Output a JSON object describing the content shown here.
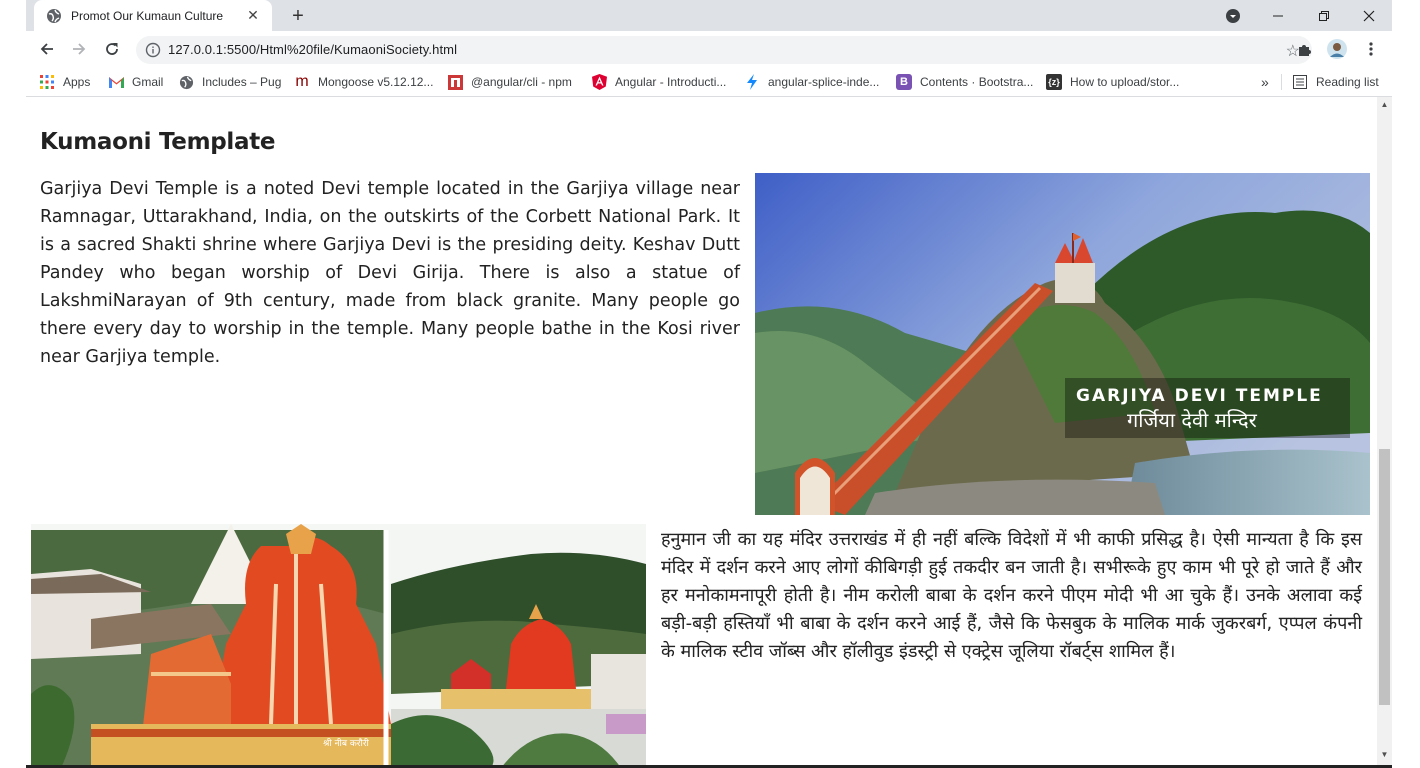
{
  "browser": {
    "tab_title": "Promot Our Kumaun Culture",
    "url": "127.0.0.1:5500/Html%20file/KumaoniSociety.html"
  },
  "bookmarks": [
    {
      "label": "Apps",
      "icon": "apps-grid-icon"
    },
    {
      "label": "Gmail",
      "icon": "gmail-icon"
    },
    {
      "label": "Includes – Pug",
      "icon": "globe-icon"
    },
    {
      "label": "Mongoose v5.12.12...",
      "icon": "mongoose-icon"
    },
    {
      "label": "@angular/cli - npm",
      "icon": "npm-icon"
    },
    {
      "label": "Angular - Introducti...",
      "icon": "angular-icon"
    },
    {
      "label": "angular-splice-inde...",
      "icon": "bolt-icon"
    },
    {
      "label": "Contents · Bootstra...",
      "icon": "bootstrap-icon"
    },
    {
      "label": "How to upload/stor...",
      "icon": "code-icon"
    }
  ],
  "reading_list_label": "Reading list",
  "more_bookmarks": "»",
  "page": {
    "heading": "Kumaoni Template",
    "paragraph1": "Garjiya Devi Temple is a noted Devi temple located in the Garjiya village near Ramnagar, Uttarakhand, India, on the outskirts of the Corbett National Park. It is a sacred Shakti shrine where Garjiya Devi is the presiding deity. Keshav Dutt Pandey who began worship of Devi Girija. There is also a statue of LakshmiNarayan of 9th century, made from black granite. Many people go there every day to worship in the temple. Many people bathe in the Kosi river near Garjiya temple.",
    "image1_caption_en": "GARJIYA DEVI TEMPLE",
    "image1_caption_hi": "गर्जिया देवी मन्दिर",
    "image2_caption": "श्री नीब करौरी",
    "paragraph2": "हनुमान जी का यह मंदिर उत्तराखंड में ही नहीं बल्कि विदेशों में भी काफी प्रसिद्ध है। ऐसी मान्यता है कि इस मंदिर में दर्शन करने आए लोगों कीबिगड़ी हुई तकदीर बन जाती है। सभीरूके हुए काम भी पूरे हो जाते हैं और हर मनोकामनापूरी होती है। नीम करोली बाबा के दर्शन करने पीएम मोदी भी आ चुके हैं। उनके अलावा कई बड़ी-बड़ी हस्तियाँ भी बाबा के दर्शन करने आई हैं, जैसे कि फेसबुक के मालिक मार्क जुकरबर्ग, एप्पल कंपनी के मालिक स्टीव जॉब्स और हॉलीवुड इंडस्ट्री से एक्ट्रेस जूलिया रॉबर्ट्स शामिल हैं।"
  },
  "colors": {
    "tabstrip": "#dee1e6",
    "omnibox": "#f1f3f4",
    "text": "#222222"
  }
}
